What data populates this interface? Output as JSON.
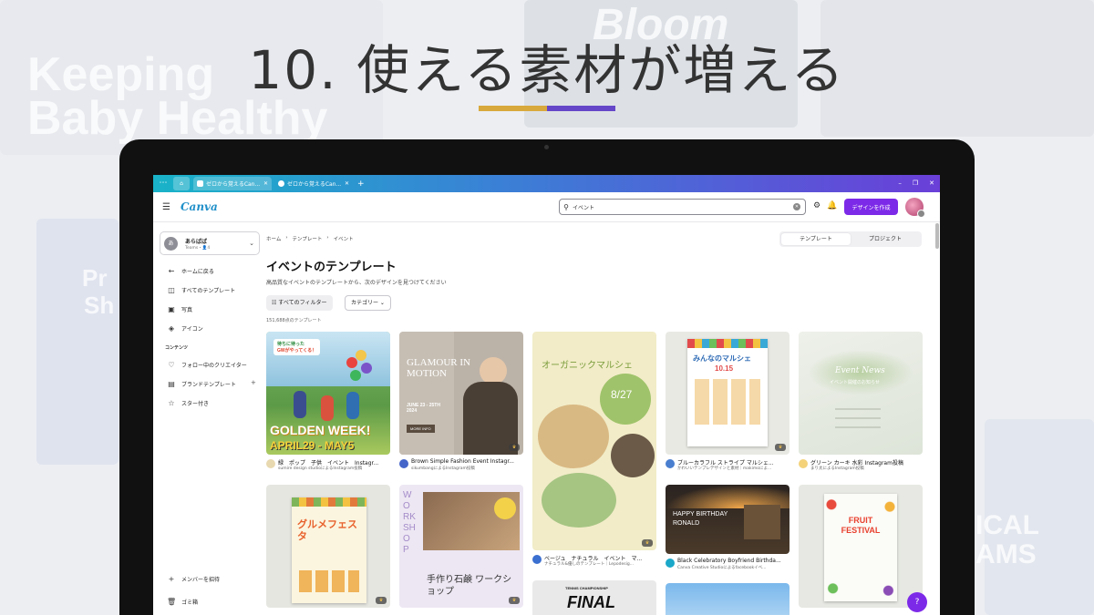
{
  "slide": {
    "title": "10. 使える素材が増える",
    "colors": {
      "bar_left": "#d8a93c",
      "bar_right": "#6546c8"
    },
    "background_words": [
      "Keeping",
      "Baby Healthy",
      "Bloom",
      "Pr",
      "Sh",
      "ICAL",
      "AMS"
    ]
  },
  "browser": {
    "menu_icon": "ellipsis-icon",
    "tabs": [
      {
        "title": "ゼロから覚えるCan...",
        "active": true
      },
      {
        "title": "ゼロから覚えるCan...",
        "active": false
      }
    ],
    "new_tab": "+",
    "window_controls": [
      "–",
      "❐",
      "✕"
    ]
  },
  "app": {
    "logo": "Canva",
    "search_value": "イベント",
    "create_button": "デザインを作成",
    "accent": "#7d2ae8"
  },
  "sidebar": {
    "team_avatar": "あ",
    "team_name": "あらばば",
    "team_sub": "Teams・👤4",
    "items": [
      {
        "label": "ホームに戻る",
        "icon": "←"
      },
      {
        "label": "すべてのテンプレート",
        "icon": "◫"
      },
      {
        "label": "写真",
        "icon": "▣"
      },
      {
        "label": "アイコン",
        "icon": "◈"
      }
    ],
    "section_content": "コンテンツ",
    "content_items": [
      {
        "label": "フォロー中のクリエイター",
        "icon": "♡"
      },
      {
        "label": "ブランドテンプレート",
        "icon": "▤"
      },
      {
        "label": "スター付き",
        "icon": "☆"
      }
    ],
    "invite": "メンバーを招待",
    "trash": "ゴミ箱"
  },
  "main": {
    "breadcrumb": [
      "ホーム",
      "›",
      "テンプレート",
      "›",
      "イベント"
    ],
    "segments": [
      "テンプレート",
      "プロジェクト"
    ],
    "title": "イベントのテンプレート",
    "subtitle": "高品質なイベントのテンプレートから、次のデザインを見つけてください",
    "filter_button": "すべてのフィルター",
    "category_button": "カテゴリー",
    "count": "151,688点のテンプレート",
    "cards": [
      {
        "title": "緑　ポップ　子供　イベント　Instagr...",
        "sub": "sumire design studioによるInstagram投稿"
      },
      {
        "title": "Brown Simple Fashion Event Instagr...",
        "sub": "sikumbangによるInstagram投稿"
      },
      {
        "title": "ベージュ　ナチュラル　イベント　マ...",
        "sub": "ナチュラル&優しのテンプレート｜Lepodesig..."
      },
      {
        "title": "ブルーカラフル ストライプ マルシェ...",
        "sub": "かわいいテンプレデザインと素材｜makimoによ..."
      },
      {
        "title": "グリーン カーキ 水彩 Instagram投稿",
        "sub": "まり太によるInstagram投稿"
      },
      {
        "title": "Black Celebratory Boyfriend Birthda...",
        "sub": "Canva Creative Studioによるfacebookイベ..."
      }
    ],
    "thumb_text": {
      "golden_top": "待ちに待った",
      "golden_sub": "GWがやってくる！",
      "golden_big": "GOLDEN WEEK!",
      "golden_date": "APRIL29 - MAY5",
      "glamour": "GLAMOUR IN MOTION",
      "glamour_date": "JUNE 23 - 25TH 2024",
      "glamour_btn": "MORE INFO",
      "organic": "オーガニックマルシェ",
      "organic_date": "8/27",
      "marche": "みんなのマルシェ",
      "marche_date": "10.15",
      "event_news": "Event News",
      "event_news_sub": "イベント開催のお知らせ",
      "gourmet": "グルメフェスタ",
      "workshop": "WORK SHOP",
      "soap": "手作り石鹸 ワークショップ",
      "birthday": "HAPPY BIRTHDAY RONALD",
      "fruit": "FRUIT FESTIVAL",
      "final": "FINAL",
      "tennis": "TENNIS CHAMPIONSHIP"
    },
    "help": "?"
  }
}
